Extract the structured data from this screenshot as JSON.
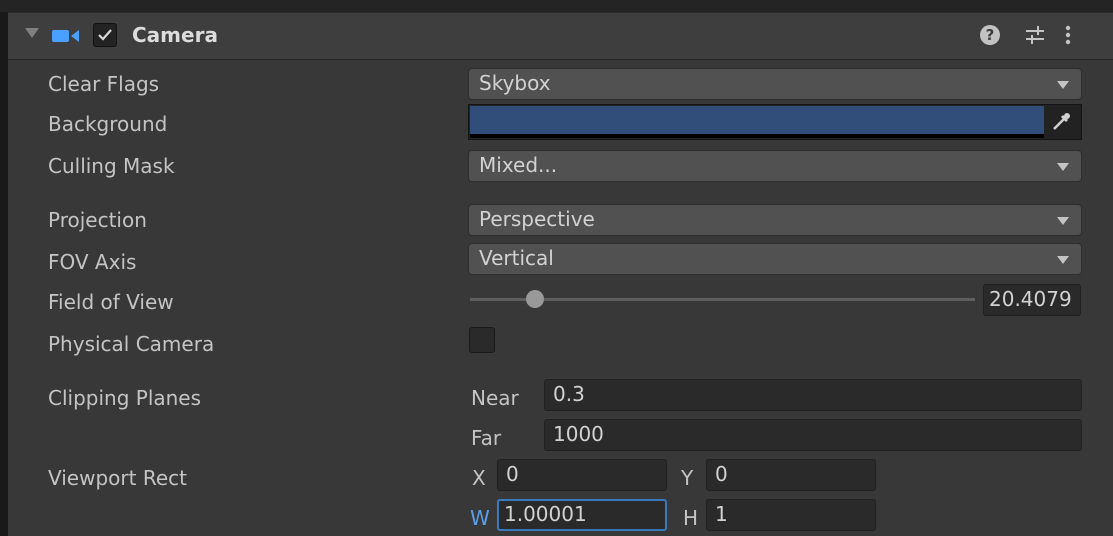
{
  "component": {
    "title": "Camera",
    "enabled": true,
    "icons": {
      "foldout": "foldout-triangle-icon",
      "component": "camera-icon",
      "help": "help-icon",
      "presets": "preset-sliders-icon",
      "menu": "kebab-menu-icon"
    },
    "help_glyph": "?"
  },
  "fields": {
    "clear_flags": {
      "label": "Clear Flags",
      "value": "Skybox"
    },
    "background": {
      "label": "Background",
      "color": "#314D79"
    },
    "culling_mask": {
      "label": "Culling Mask",
      "value": "Mixed..."
    },
    "projection": {
      "label": "Projection",
      "value": "Perspective"
    },
    "fov_axis": {
      "label": "FOV Axis",
      "value": "Vertical"
    },
    "field_of_view": {
      "label": "Field of View",
      "value": "20.4079",
      "value_display": "20.4079"
    },
    "physical_camera": {
      "label": "Physical Camera",
      "checked": false
    },
    "clipping_planes": {
      "label": "Clipping Planes",
      "near_label": "Near",
      "near": "0.3",
      "far_label": "Far",
      "far": "1000"
    },
    "viewport_rect": {
      "label": "Viewport Rect",
      "x_label": "X",
      "x": "0",
      "y_label": "Y",
      "y": "0",
      "w_label": "W",
      "w": "1.00001",
      "h_label": "H",
      "h": "1"
    }
  },
  "colors": {
    "panel_bg": "#383838",
    "header_bg": "#3e3e3e",
    "dropdown_bg": "#515151",
    "field_bg": "#2a2a2a",
    "focus": "#3a79bb",
    "accent_icon": "#4aa0ff"
  }
}
